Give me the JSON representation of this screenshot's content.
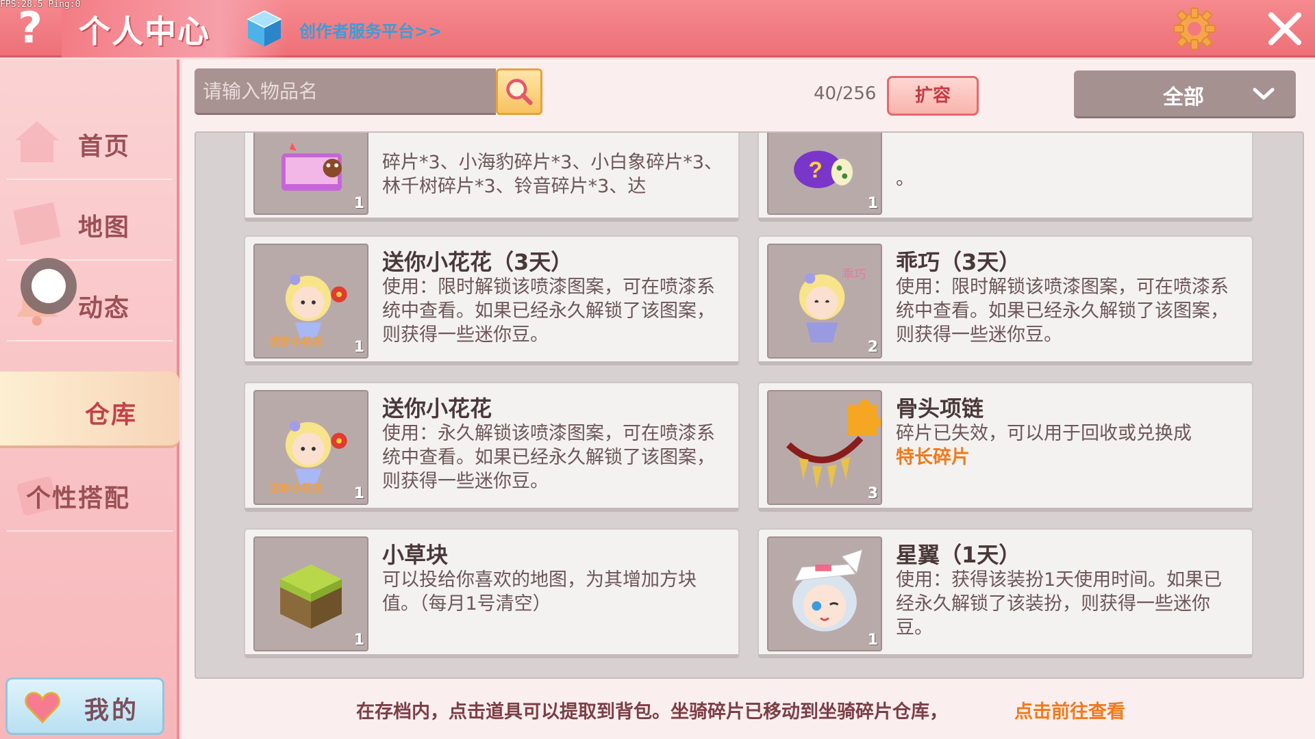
{
  "overlay": {
    "fps": "FPS:28.5  Ping:0"
  },
  "header": {
    "help_icon": "?",
    "title": "个人中心",
    "creator_link": "创作者服务平台>>",
    "icons": {
      "help": "question-icon",
      "creator": "cube-icon",
      "settings": "gear-icon",
      "close": "close-icon"
    },
    "accent": "#ee7078"
  },
  "sidebar": {
    "items": [
      {
        "label": "首页",
        "icon": "house-icon",
        "active": false
      },
      {
        "label": "地图",
        "icon": "map-icon",
        "active": false
      },
      {
        "label": "动态",
        "icon": "bell-icon",
        "active": false
      },
      {
        "label": "仓库",
        "icon": "box-icon",
        "active": true
      },
      {
        "label": "个性搭配",
        "icon": "outfit-icon",
        "active": false
      }
    ],
    "mine_button": {
      "label": "我的",
      "icon": "heart-icon"
    }
  },
  "toolbar": {
    "search_placeholder": "请输入物品名",
    "capacity": "40/256",
    "expand_label": "扩容",
    "filter_label": "全部"
  },
  "items": [
    {
      "name": "",
      "desc": "碎片*3、小海豹碎片*3、小白象碎片*3、林千树碎片*3、铃音碎片*3、达",
      "count": "1",
      "icon": "gift-box-icon"
    },
    {
      "name": "",
      "desc": "。",
      "count": "1",
      "icon": "mystery-bag-icon"
    },
    {
      "name": "送你小花花（3天）",
      "desc": "使用：限时解锁该喷漆图案，可在喷漆系统中查看。如果已经永久解锁了该图案，则获得一些迷你豆。",
      "count": "1",
      "icon": "flower-girl-sticker-icon"
    },
    {
      "name": "乖巧（3天）",
      "desc": "使用：限时解锁该喷漆图案，可在喷漆系统中查看。如果已经永久解锁了该图案，则获得一些迷你豆。",
      "count": "2",
      "icon": "cute-girl-sticker-icon"
    },
    {
      "name": "送你小花花",
      "desc": "使用：永久解锁该喷漆图案，可在喷漆系统中查看。如果已经永久解锁了该图案，则获得一些迷你豆。",
      "count": "1",
      "icon": "flower-girl-sticker-icon"
    },
    {
      "name": "骨头项链",
      "desc": "碎片已失效，可以用于回收或兑换成",
      "highlight": "特长碎片",
      "count": "3",
      "icon": "bone-necklace-icon"
    },
    {
      "name": "小草块",
      "desc": "可以投给你喜欢的地图，为其增加方块值。（每月1号清空）",
      "count": "1",
      "icon": "grass-block-icon"
    },
    {
      "name": "星翼（1天）",
      "desc": "使用：获得该装扮1天使用时间。如果已经永久解锁了该装扮，则获得一些迷你豆。",
      "count": "1",
      "icon": "anime-avatar-icon"
    }
  ],
  "footer": {
    "tip": "在存档内，点击道具可以提取到背包。坐骑碎片已移动到坐骑碎片仓库，",
    "link": "点击前往查看"
  }
}
